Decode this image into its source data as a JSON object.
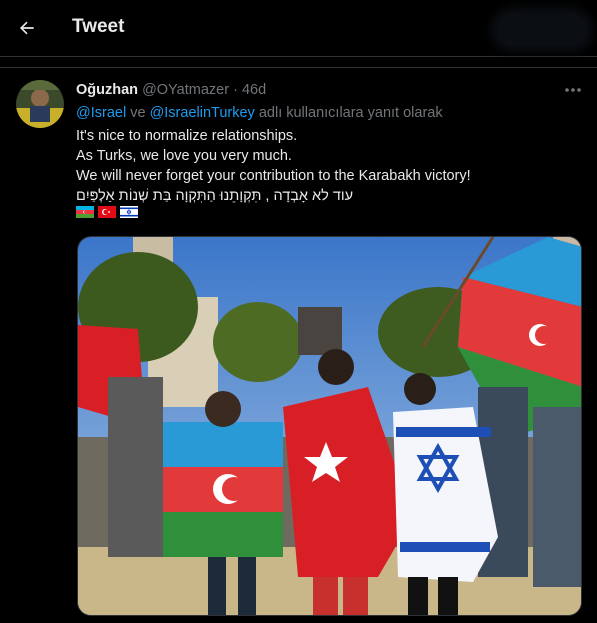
{
  "header": {
    "title": "Tweet",
    "back_icon": "arrow-left-icon"
  },
  "tweet": {
    "author_name": "Oğuzhan",
    "handle": "@OYatmazer",
    "separator": "·",
    "time": "46d",
    "reply_to": {
      "mention_1": "@Israel",
      "joiner": " ve ",
      "mention_2": "@IsraelinTurkey",
      "suffix": " adlı kullanıcılara yanıt olarak"
    },
    "lines": [
      "It's nice to normalize relationships.",
      "As Turks, we love you very much.",
      "We will never forget your contribution to the Karabakh victory!",
      "עוד לא אָבְדָה , תִּקְוָתֵנוּ הַתִּקְוָה בַּת שְׁנוֹת אַלְפַּיִם"
    ],
    "flags": [
      "azerbaijan-flag",
      "turkey-flag",
      "israel-flag"
    ],
    "more_icon": "more-dots-icon",
    "media_description_icon": "photo"
  },
  "colors": {
    "background": "#000000",
    "text": "#e7e9ea",
    "muted": "#71767b",
    "link": "#1d9bf0",
    "border": "#2f3336"
  }
}
